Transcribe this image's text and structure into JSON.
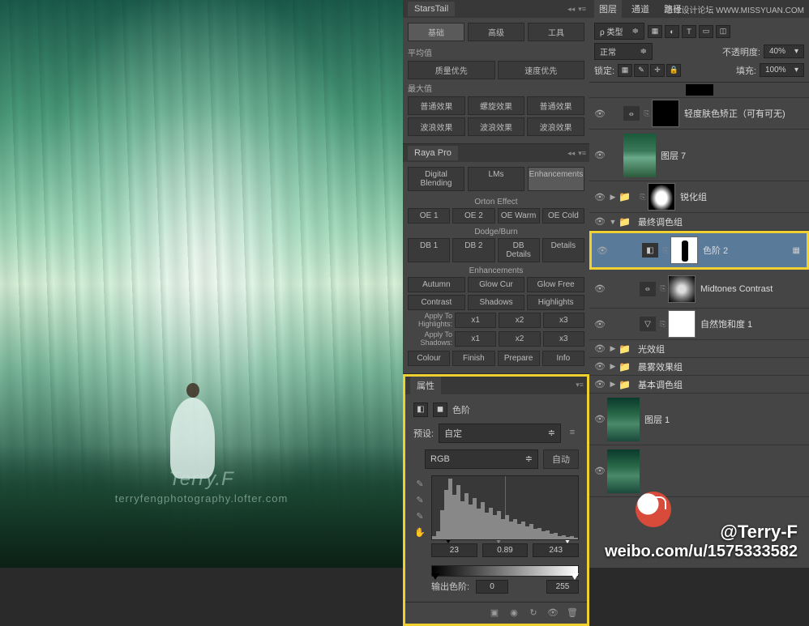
{
  "preview": {
    "watermark_line1": "Terry.F",
    "watermark_line2": "terryfengphotography.lofter.com"
  },
  "starstail": {
    "title": "StarsTail",
    "tabs": [
      "基础",
      "高级",
      "工具"
    ],
    "avg_label": "平均值",
    "avg_buttons": [
      "质量优先",
      "速度优先"
    ],
    "max_label": "最大值",
    "max_buttons1": [
      "普通效果",
      "螺旋效果",
      "普通效果"
    ],
    "max_buttons2": [
      "波浪效果",
      "波浪效果",
      "波浪效果"
    ]
  },
  "raya": {
    "title": "Raya Pro",
    "tabs": [
      "Digital Blending",
      "LMs",
      "Enhancements"
    ],
    "orton_title": "Orton Effect",
    "orton_buttons": [
      "OE 1",
      "OE 2",
      "OE Warm",
      "OE Cold"
    ],
    "dodge_title": "Dodge/Burn",
    "dodge_buttons": [
      "DB 1",
      "DB 2",
      "DB Details",
      "Details"
    ],
    "enh_title": "Enhancements",
    "enh_row1": [
      "Autumn",
      "Glow Cur",
      "Glow Free"
    ],
    "enh_row2": [
      "Contrast",
      "Shadows",
      "Highlights"
    ],
    "apply_hi": "Apply To Highlights:",
    "apply_sh": "Apply To Shadows:",
    "multipliers": [
      "x1",
      "x2",
      "x3"
    ],
    "bottom": [
      "Colour",
      "Finish",
      "Prepare",
      "Info"
    ]
  },
  "properties": {
    "title": "属性",
    "type_label": "色阶",
    "preset_label": "预设:",
    "preset_value": "自定",
    "channel": "RGB",
    "auto": "自动",
    "levels": {
      "black": "23",
      "gamma": "0.89",
      "white": "243"
    },
    "output_label": "输出色阶:",
    "output": {
      "black": "0",
      "white": "255"
    }
  },
  "layers_panel": {
    "tabs": [
      "图层",
      "通道",
      "路径"
    ],
    "brand": "思缘设计论坛   WWW.MISSYUAN.COM",
    "kind_label": "类型",
    "blend_mode": "正常",
    "opacity_label": "不透明度:",
    "opacity_value": "40%",
    "lock_label": "锁定:",
    "fill_label": "填充:",
    "fill_value": "100%",
    "layers": [
      {
        "name": "轻度肤色矫正（可有可无)",
        "type": "adj",
        "mask": "black"
      },
      {
        "name": "图层 7",
        "type": "img"
      },
      {
        "name": "锐化组",
        "type": "group",
        "mask": "glow",
        "collapsed": true
      },
      {
        "name": "最终调色组",
        "type": "group",
        "collapsed": false
      },
      {
        "name": "色阶 2",
        "type": "levels",
        "selected": true,
        "mask": "figure"
      },
      {
        "name": "Midtones Contrast",
        "type": "adj",
        "mask": "texture"
      },
      {
        "name": "自然饱和度 1",
        "type": "adj",
        "mask": "white"
      },
      {
        "name": "光效组",
        "type": "group",
        "collapsed": true
      },
      {
        "name": "晨雾效果组",
        "type": "group",
        "collapsed": true
      },
      {
        "name": "基本调色组",
        "type": "group",
        "collapsed": true
      },
      {
        "name": "图层 1",
        "type": "img2"
      },
      {
        "name": "",
        "type": "img2"
      }
    ]
  },
  "credit": {
    "line1": "@Terry-F",
    "line2": "weibo.com/u/1575333582"
  }
}
